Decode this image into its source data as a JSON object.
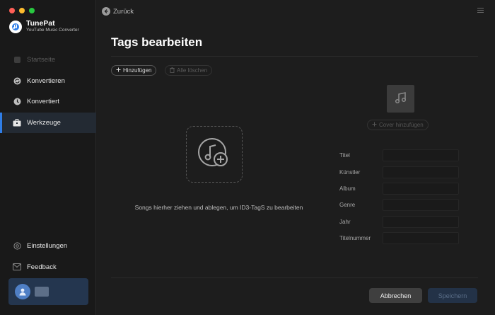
{
  "app": {
    "name": "TunePat",
    "subtitle": "YouTube Music Converter"
  },
  "sidebar": {
    "items": [
      {
        "label": "Startseite",
        "icon": "home-icon",
        "state": "disabled"
      },
      {
        "label": "Konvertieren",
        "icon": "convert-icon",
        "state": "normal"
      },
      {
        "label": "Konvertiert",
        "icon": "clock-icon",
        "state": "normal"
      },
      {
        "label": "Werkzeuge",
        "icon": "toolbox-icon",
        "state": "active"
      }
    ],
    "bottom_items": [
      {
        "label": "Einstellungen",
        "icon": "gear-icon"
      },
      {
        "label": "Feedback",
        "icon": "mail-icon"
      }
    ]
  },
  "header": {
    "back_label": "Zurück"
  },
  "page": {
    "title": "Tags bearbeiten",
    "add_label": "Hinzufügen",
    "clear_label": "Alle löschen",
    "drop_text": "Songs hierher ziehen und ablegen, um ID3-TagS zu bearbeiten",
    "cover_label": "Cover hinzufügen",
    "fields": [
      {
        "label": "Titel",
        "value": ""
      },
      {
        "label": "Künstler",
        "value": ""
      },
      {
        "label": "Album",
        "value": ""
      },
      {
        "label": "Genre",
        "value": ""
      },
      {
        "label": "Jahr",
        "value": ""
      },
      {
        "label": "Titelnummer",
        "value": ""
      }
    ]
  },
  "footer": {
    "cancel_label": "Abbrechen",
    "save_label": "Speichern"
  },
  "colors": {
    "accent": "#2f7ee8",
    "background": "#1d1d1d",
    "sidebar": "#191919"
  }
}
